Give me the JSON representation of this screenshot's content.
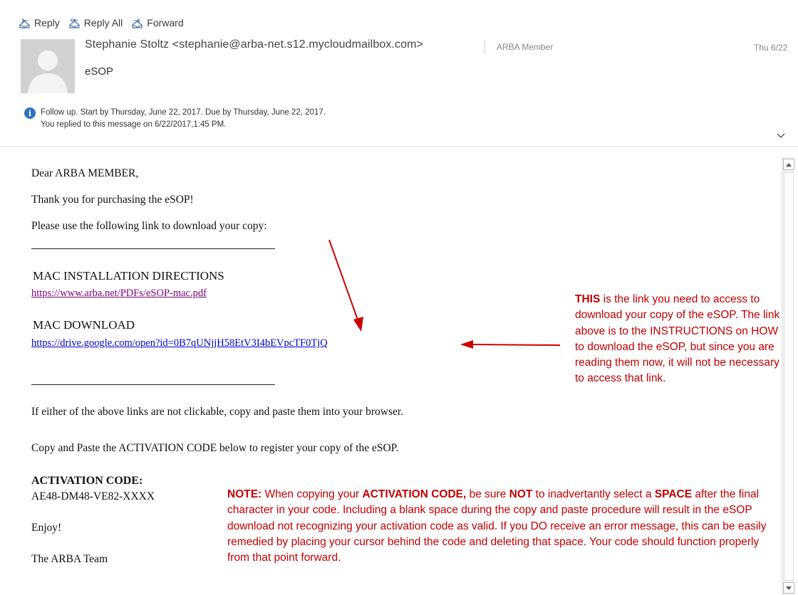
{
  "toolbar": {
    "reply": "Reply",
    "reply_all": "Reply All",
    "forward": "Forward"
  },
  "message_header": {
    "sender": "Stephanie Stoltz <stephanie@arba-net.s12.mycloudmailbox.com>",
    "category": "ARBA Member",
    "date": "Thu 6/22",
    "subject": "eSOP",
    "followup": "Follow up.  Start by Thursday, June 22, 2017.  Due by Thursday, June 22, 2017.",
    "replied": "You replied to this message on 6/22/2017,1:45 PM."
  },
  "body": {
    "greeting": "Dear ARBA MEMBER,",
    "thanks": "Thank you for purchasing the eSOP!",
    "instruction": "Please use the following link to download your copy:",
    "mac_install_heading": "MAC INSTALLATION DIRECTIONS",
    "mac_install_link": "https://www.arba.net/PDFs/eSOP-mac.pdf",
    "mac_download_heading": "MAC DOWNLOAD",
    "mac_download_link": "https://drive.google.com/open?id=0B7qUNjjH58EtV3I4bEVpcTF0TjQ",
    "not_clickable": "If either of the above links are not clickable, copy and paste them into your browser.",
    "copy_paste": "Copy and Paste the ACTIVATION CODE below to register your copy of the eSOP.",
    "activation_heading": "ACTIVATION CODE:",
    "activation_code": "AE48-DM48-VE82-XXXX",
    "enjoy": "Enjoy!",
    "signoff": "The ARBA Team"
  },
  "annotations": {
    "right_note": {
      "emph": "THIS",
      "text": " is the link you need to access to download your copy of the eSOP. The link above is to the INSTRUCTIONS on HOW to download the eSOP, but since you are reading them now, it will not be necessary to access that link."
    },
    "bottom_note": {
      "p1": "NOTE:",
      "p2": " When copying your ",
      "p3": "ACTIVATION CODE,",
      "p4": " be sure ",
      "p5": "NOT",
      "p6": " to inadvertantly select a ",
      "p7": "SPACE",
      "p8": " after the final character in your code. Including a blank space during the copy and paste procedure will result in the eSOP download not recognizing your activation code as valid.  If you DO receive an error message, this can be easily remedied by placing your cursor behind the code and deleting that space.  Your code should function properly from that point forward."
    }
  },
  "colors": {
    "annotation": "#c00000",
    "link": "#0000cc",
    "visited_link": "#800080",
    "info": "#2e72c2"
  },
  "icons": [
    "reply-icon",
    "reply-all-icon",
    "forward-icon",
    "info-icon",
    "chevron-down-icon",
    "scroll-up-icon",
    "scroll-down-icon"
  ]
}
